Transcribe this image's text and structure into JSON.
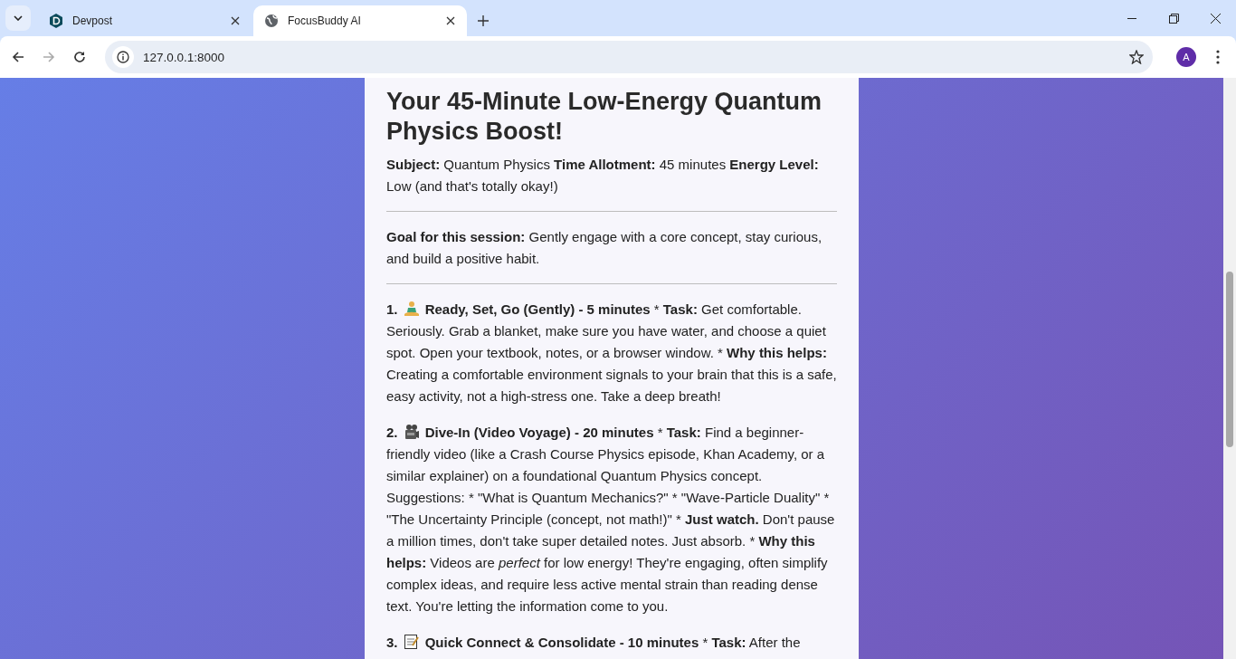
{
  "browser": {
    "tabs": [
      {
        "title": "Devpost",
        "selected": false
      },
      {
        "title": "FocusBuddy AI",
        "selected": true
      }
    ],
    "address": "127.0.0.1:8000",
    "profile_initial": "A"
  },
  "plan": {
    "title": "Your 45-Minute Low-Energy Quantum Physics Boost!",
    "summary": "**Subject:** Quantum Physics **Time Allotment:** 45 minutes **Energy Level:** Low (and that's totally okay!)",
    "goal": "**Goal for this session:** Gently engage with a core concept, stay curious, and build a positive habit.",
    "steps": [
      {
        "number": "1.",
        "text": "**Ready, Set, Go (Gently) - 5 minutes** * **Task:** Get comfortable. Seriously. Grab a blanket, make sure you have water, and choose a quiet spot. Open your textbook, notes, or a browser window. * **Why this helps:** Creating a comfortable environment signals to your brain that this is a safe, easy activity, not a high-stress one. Take a deep breath!"
      },
      {
        "number": "2.",
        "text": "**Dive-In (Video Voyage) - 20 minutes** * **Task:** Find a beginner-friendly video (like a Crash Course Physics episode, Khan Academy, or a similar explainer) on a foundational Quantum Physics concept. Suggestions: * \"What is Quantum Mechanics?\" * \"Wave-Particle Duality\" * \"The Uncertainty Principle (concept, not math!)\" * **Just watch.** Don't pause a million times, don't take super detailed notes. Just absorb. * **Why this helps:** Videos are *perfect* for low energy! They're engaging, often simplify complex ideas, and require less active mental strain than reading dense text. You're letting the information come to you."
      },
      {
        "number": "3.",
        "text": "**Quick Connect & Consolidate - 10 minutes** * **Task:** After the"
      }
    ]
  }
}
